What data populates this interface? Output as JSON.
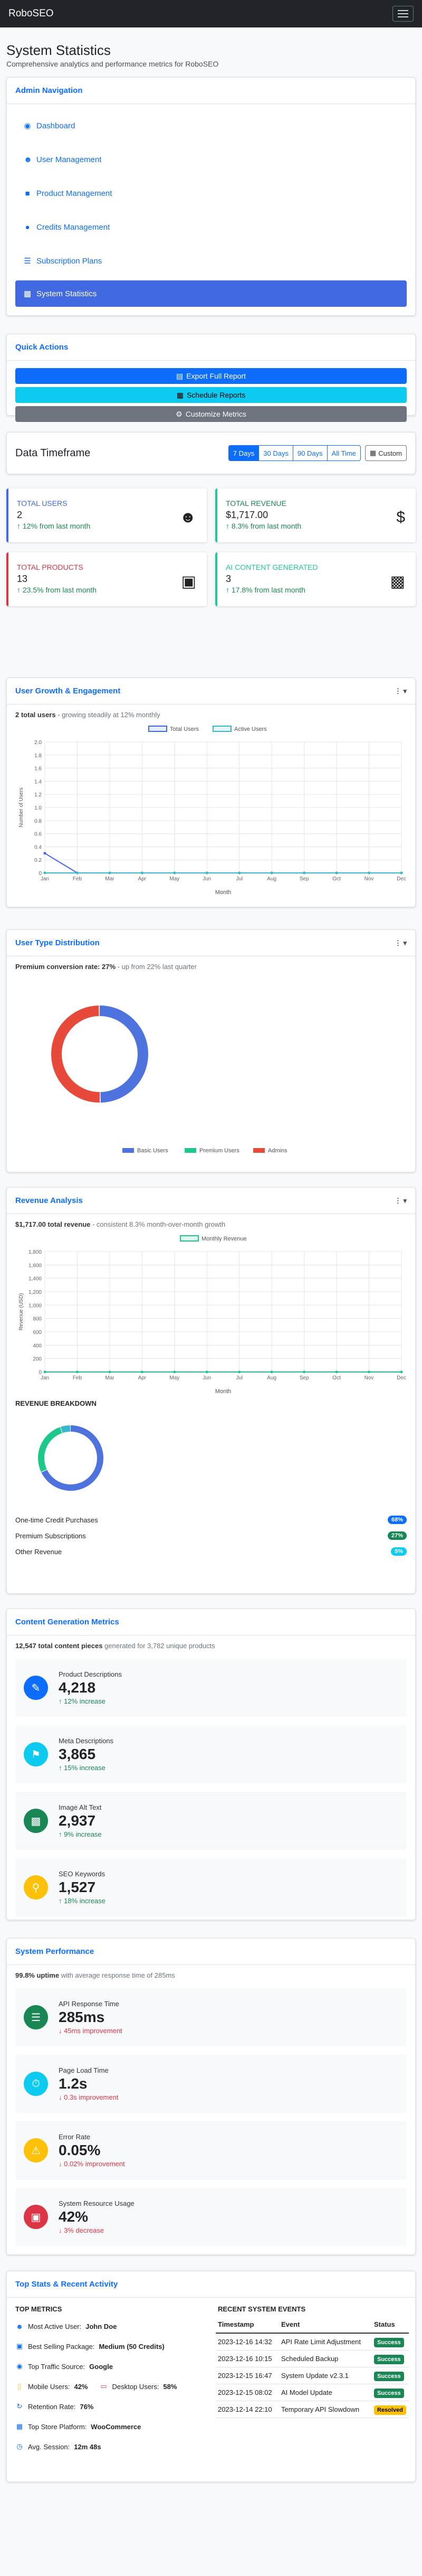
{
  "app": {
    "brand": "RoboSEO"
  },
  "header": {
    "title": "System Statistics",
    "subtitle": "Comprehensive analytics and performance metrics for RoboSEO"
  },
  "admin_nav": {
    "title": "Admin Navigation",
    "items": [
      {
        "label": "Dashboard",
        "icon": "gauge-icon"
      },
      {
        "label": "User Management",
        "icon": "users-icon"
      },
      {
        "label": "Product Management",
        "icon": "box-icon"
      },
      {
        "label": "Credits Management",
        "icon": "coins-icon"
      },
      {
        "label": "Subscription Plans",
        "icon": "list-icon"
      },
      {
        "label": "System Statistics",
        "icon": "chart-icon"
      }
    ]
  },
  "quick_actions": {
    "title": "Quick Actions",
    "items": [
      {
        "label": "Export Full Report",
        "color": "#0d6efd"
      },
      {
        "label": "Schedule Reports",
        "color": "#0dcaf0"
      },
      {
        "label": "Customize Metrics",
        "color": "#6c757d"
      }
    ]
  },
  "timeframe": {
    "title": "Data Timeframe",
    "options": [
      "7 Days",
      "30 Days",
      "90 Days",
      "All Time"
    ],
    "custom_label": "Custom"
  },
  "stats": [
    {
      "label": "TOTAL USERS",
      "value": "2",
      "change": "12% from last month",
      "color": "#4169e1",
      "icon": "users-icon"
    },
    {
      "label": "TOTAL REVENUE",
      "value": "$1,717.00",
      "change": "8.3% from last month",
      "color": "#20c997",
      "icon": "dollar-icon"
    },
    {
      "label": "TOTAL PRODUCTS",
      "value": "13",
      "change": "23.5% from last month",
      "color": "#dc3545",
      "icon": "box-icon"
    },
    {
      "label": "AI CONTENT GENERATED",
      "value": "3",
      "change": "17.8% from last month",
      "color": "#20c997",
      "icon": "robot-icon"
    }
  ],
  "user_growth": {
    "title": "User Growth & Engagement",
    "summary_bold": "2 total users",
    "summary_rest": " - growing steadily at 12% monthly"
  },
  "user_type": {
    "title": "User Type Distribution",
    "summary_bold": "Premium conversion rate: 27%",
    "summary_rest": " - up from 22% last quarter"
  },
  "revenue": {
    "title": "Revenue Analysis",
    "summary_bold": "$1,717.00 total revenue",
    "summary_rest": " - consistent 8.3% month-over-month growth",
    "breakdown_title": "REVENUE BREAKDOWN",
    "breakdown": [
      {
        "label": "One-time Credit Purchases",
        "pct": "68%",
        "color": "#0d6efd"
      },
      {
        "label": "Premium Subscriptions",
        "pct": "27%",
        "color": "#198754"
      },
      {
        "label": "Other Revenue",
        "pct": "5%",
        "color": "#0dcaf0"
      }
    ]
  },
  "content_metrics": {
    "title": "Content Generation Metrics",
    "summary_bold": "12,547 total content pieces",
    "summary_rest": " generated for 3,782 unique products",
    "items": [
      {
        "label": "Product Descriptions",
        "value": "4,218",
        "change": "12% increase",
        "color": "#0d6efd",
        "icon": "pencil-icon",
        "dir": "up"
      },
      {
        "label": "Meta Descriptions",
        "value": "3,865",
        "change": "15% increase",
        "color": "#0dcaf0",
        "icon": "tag-icon",
        "dir": "up"
      },
      {
        "label": "Image Alt Text",
        "value": "2,937",
        "change": "9% increase",
        "color": "#198754",
        "icon": "image-icon",
        "dir": "up"
      },
      {
        "label": "SEO Keywords",
        "value": "1,527",
        "change": "18% increase",
        "color": "#ffc107",
        "icon": "key-icon",
        "dir": "up"
      }
    ]
  },
  "performance": {
    "title": "System Performance",
    "summary_bold": "99.8% uptime",
    "summary_rest": " with average response time of 285ms",
    "items": [
      {
        "label": "API Response Time",
        "value": "285ms",
        "change": "45ms improvement",
        "color": "#198754",
        "icon": "server-icon",
        "dir": "down"
      },
      {
        "label": "Page Load Time",
        "value": "1.2s",
        "change": "0.3s improvement",
        "color": "#0dcaf0",
        "icon": "stopwatch-icon",
        "dir": "down"
      },
      {
        "label": "Error Rate",
        "value": "0.05%",
        "change": "0.02% improvement",
        "color": "#ffc107",
        "icon": "warning-icon",
        "dir": "down"
      },
      {
        "label": "System Resource Usage",
        "value": "42%",
        "change": "3% decrease",
        "color": "#dc3545",
        "icon": "memory-icon",
        "dir": "down"
      }
    ]
  },
  "top_stats": {
    "title": "Top Stats & Recent Activity",
    "metrics_title": "TOP METRICS",
    "events_title": "RECENT SYSTEM EVENTS",
    "metrics": {
      "most_active_label": "Most Active User:",
      "most_active_value": "John Doe",
      "best_pkg_label": "Best Selling Package:",
      "best_pkg_value": "Medium (50 Credits)",
      "traffic_label": "Top Traffic Source:",
      "traffic_value": "Google",
      "mobile_label": "Mobile Users:",
      "mobile_value": "42%",
      "desktop_label": "Desktop Users:",
      "desktop_value": "58%",
      "retention_label": "Retention Rate:",
      "retention_value": "76%",
      "platform_label": "Top Store Platform:",
      "platform_value": "WooCommerce",
      "session_label": "Avg. Session:",
      "session_value": "12m 48s"
    },
    "columns": [
      "Timestamp",
      "Event",
      "Status"
    ],
    "events": [
      {
        "time": "2023-12-16 14:32",
        "event": "API Rate Limit Adjustment",
        "status": "Success",
        "color": "#198754"
      },
      {
        "time": "2023-12-16 10:15",
        "event": "Scheduled Backup",
        "status": "Success",
        "color": "#198754"
      },
      {
        "time": "2023-12-15 16:47",
        "event": "System Update v2.3.1",
        "status": "Success",
        "color": "#198754"
      },
      {
        "time": "2023-12-15 08:02",
        "event": "AI Model Update",
        "status": "Success",
        "color": "#198754"
      },
      {
        "time": "2023-12-14 22:10",
        "event": "Temporary API Slowdown",
        "status": "Resolved",
        "color": "#ffc107"
      }
    ]
  },
  "chart_data": [
    {
      "type": "line",
      "categories": [
        "Jan",
        "Feb",
        "Mar",
        "Apr",
        "May",
        "Jun",
        "Jul",
        "Aug",
        "Sep",
        "Oct",
        "Nov",
        "Dec"
      ],
      "series": [
        {
          "name": "Total Users",
          "values": [
            0.3,
            0,
            0,
            0,
            0,
            0,
            0,
            0,
            0,
            0,
            0,
            0
          ],
          "color": "#4169e1"
        },
        {
          "name": "Active Users",
          "values": [
            0,
            0,
            0,
            0,
            0,
            0,
            0,
            0,
            0,
            0,
            0,
            0
          ],
          "color": "#36b9cc"
        }
      ],
      "xlabel": "Month",
      "ylabel": "Number of Users",
      "ylim": [
        0,
        2.0
      ],
      "yticks": [
        "0",
        "0.2",
        "0.4",
        "0.6",
        "0.8",
        "1.0",
        "1.2",
        "1.4",
        "1.6",
        "1.8",
        "2.0"
      ]
    },
    {
      "type": "pie",
      "labels": [
        "Basic Users",
        "Premium Users",
        "Admins"
      ],
      "values": [
        50,
        0,
        50
      ],
      "colors": [
        "#4e73df",
        "#1cc88a",
        "#e74a3b"
      ]
    },
    {
      "type": "line",
      "categories": [
        "Jan",
        "Feb",
        "Mar",
        "Apr",
        "May",
        "Jun",
        "Jul",
        "Aug",
        "Sep",
        "Oct",
        "Nov",
        "Dec"
      ],
      "series": [
        {
          "name": "Monthly Revenue",
          "values": [
            0,
            0,
            0,
            0,
            0,
            0,
            0,
            0,
            0,
            0,
            0,
            0
          ],
          "color": "#1cc88a"
        }
      ],
      "xlabel": "Month",
      "ylabel": "Revenue (USD)",
      "ylim": [
        0,
        1800
      ],
      "yticks": [
        "0",
        "200",
        "400",
        "600",
        "800",
        "1,000",
        "1,200",
        "1,400",
        "1,600",
        "1,800"
      ]
    },
    {
      "type": "pie",
      "labels": [
        "One-time Credit Purchases",
        "Premium Subscriptions",
        "Other Revenue"
      ],
      "values": [
        68,
        27,
        5
      ],
      "colors": [
        "#4e73df",
        "#1cc88a",
        "#36b9cc"
      ]
    }
  ]
}
